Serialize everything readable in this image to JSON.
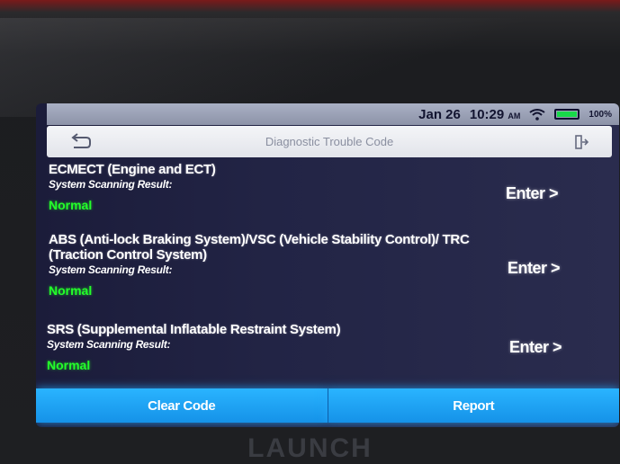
{
  "status": {
    "date": "Jan 26",
    "time": "10:29",
    "ampm": "AM",
    "battery": "100%",
    "battery_level": 1.0,
    "battery_color": "#18d84a"
  },
  "header": {
    "title": "Diagnostic Trouble Code",
    "back_icon": "back-arrow-icon",
    "exit_icon": "exit-icon"
  },
  "items": [
    {
      "title": "ECMECT (Engine and ECT)",
      "subtitle": "System Scanning Result:",
      "status": "Normal",
      "action": "Enter >"
    },
    {
      "title": "ABS (Anti-lock Braking System)/VSC (Vehicle Stability Control)/ TRC (Traction Control System)",
      "subtitle": "System Scanning Result:",
      "status": "Normal",
      "action": "Enter >"
    },
    {
      "title": "SRS (Supplemental Inflatable Restraint System)",
      "subtitle": "System Scanning Result:",
      "status": "Normal",
      "action": "Enter >"
    }
  ],
  "footer": {
    "clear_label": "Clear Code",
    "report_label": "Report"
  },
  "brand": "LAUNCH",
  "colors": {
    "accent": "#1a9ef5",
    "status_ok": "#23ff2a"
  }
}
